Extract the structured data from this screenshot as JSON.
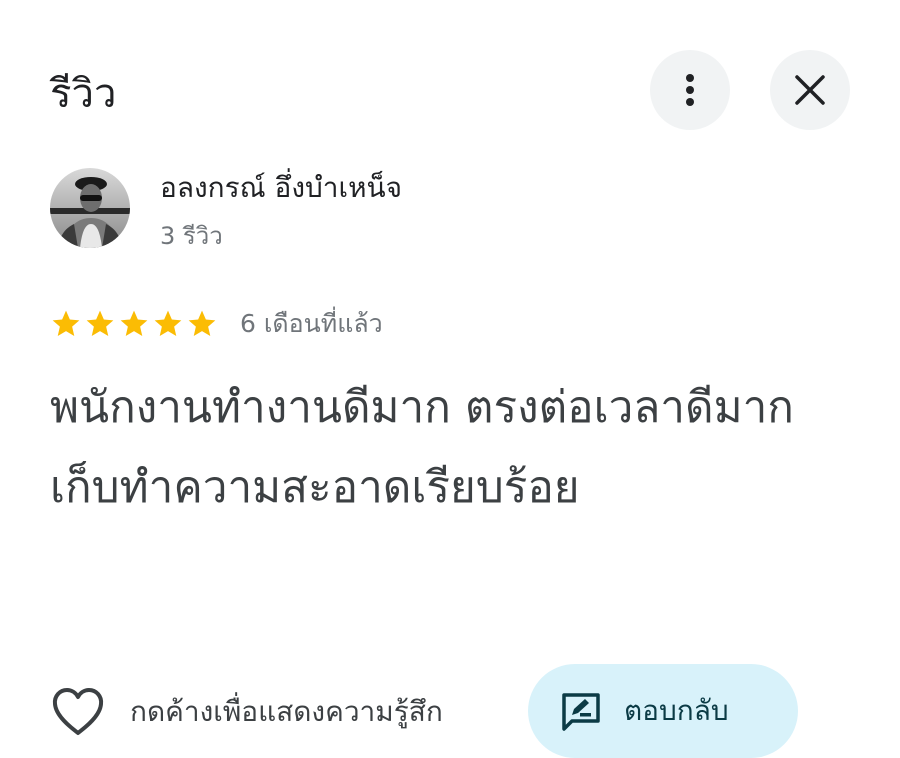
{
  "header": {
    "title": "รีวิว",
    "more_icon": "more-vert-icon",
    "close_icon": "close-icon"
  },
  "reviewer": {
    "name": "อลงกรณ์ อึ่งบำเหน็จ",
    "review_count": "3 รีวิว"
  },
  "review": {
    "rating": 5,
    "max_rating": 5,
    "star_color": "#fbbc04",
    "time": "6 เดือนที่แล้ว",
    "text": "พนักงานทำงานดีมาก ตรงต่อเวลาดีมาก เก็บทำความสะอาดเรียบร้อย"
  },
  "actions": {
    "like_label": "กดค้างเพื่อแสดงความรู้สึก",
    "like_icon": "heart-outline-icon",
    "reply_label": "ตอบกลับ",
    "reply_icon": "rate-review-icon",
    "reply_bg": "#d8f2fa"
  }
}
